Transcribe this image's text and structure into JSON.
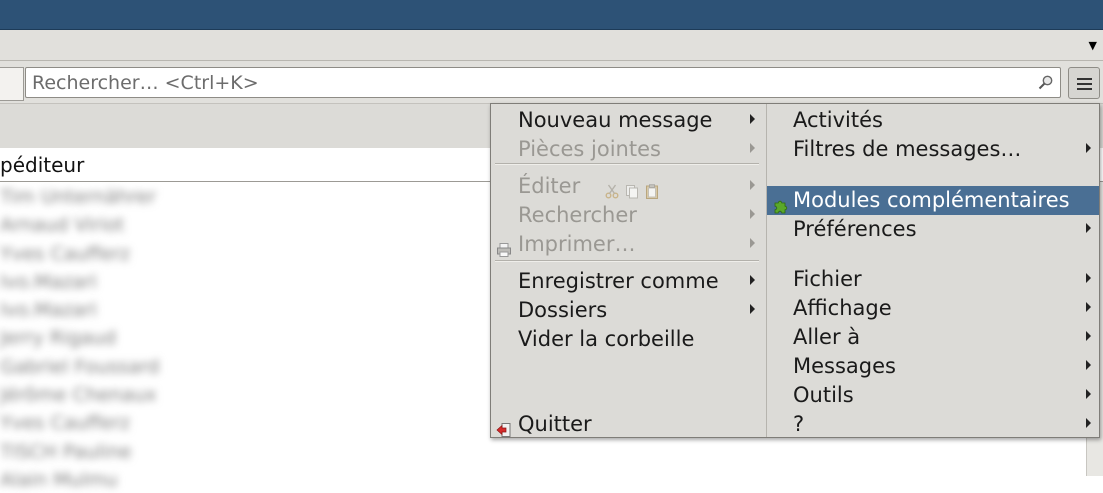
{
  "search": {
    "placeholder": "Rechercher… <Ctrl+K>"
  },
  "list": {
    "column_header": "péditeur",
    "rows": [
      "Tim Unternährer",
      "Arnaud Viriot",
      "Yves Caufferz",
      "Ivo.Mazari",
      "Ivo.Mazari",
      "Jerry Rigaud",
      "Gabriel Foussard",
      "Jérôme Chenaux",
      "Yves Caufferz",
      "TISCH Pauline",
      "Alain Mulmu"
    ]
  },
  "menu": {
    "left": [
      {
        "label": "Nouveau message",
        "submenu": true,
        "disabled": false
      },
      {
        "label": "Pièces jointes",
        "submenu": true,
        "disabled": true
      },
      {
        "label": "Éditer",
        "submenu": true,
        "disabled": true,
        "icons": [
          "scissors-icon",
          "copy-icon",
          "paste-icon"
        ]
      },
      {
        "label": "Rechercher",
        "submenu": true,
        "disabled": true
      },
      {
        "label": "Imprimer…",
        "submenu": true,
        "disabled": true,
        "icon": "printer-icon"
      },
      {
        "label": "Enregistrer comme",
        "submenu": true,
        "disabled": false
      },
      {
        "label": "Dossiers",
        "submenu": true,
        "disabled": false
      },
      {
        "label": "Vider la corbeille",
        "submenu": false,
        "disabled": false
      },
      {
        "label": "Quitter",
        "submenu": false,
        "disabled": false,
        "icon": "quit-icon"
      }
    ],
    "right": [
      {
        "label": "Activités",
        "submenu": false
      },
      {
        "label": "Filtres de messages…",
        "submenu": true
      },
      {
        "label": "Modules complémentaires",
        "submenu": false,
        "highlighted": true,
        "icon": "puzzle-icon"
      },
      {
        "label": "Préférences",
        "submenu": true
      },
      {
        "label": "Fichier",
        "submenu": true
      },
      {
        "label": "Affichage",
        "submenu": true
      },
      {
        "label": "Aller à",
        "submenu": true
      },
      {
        "label": "Messages",
        "submenu": true
      },
      {
        "label": "Outils",
        "submenu": true
      },
      {
        "label": "?",
        "submenu": true
      }
    ]
  },
  "colors": {
    "titlebar": "#2d5276",
    "menu_bg": "#dcdbd7",
    "highlight": "#4a6f94",
    "disabled": "#9a9893"
  }
}
